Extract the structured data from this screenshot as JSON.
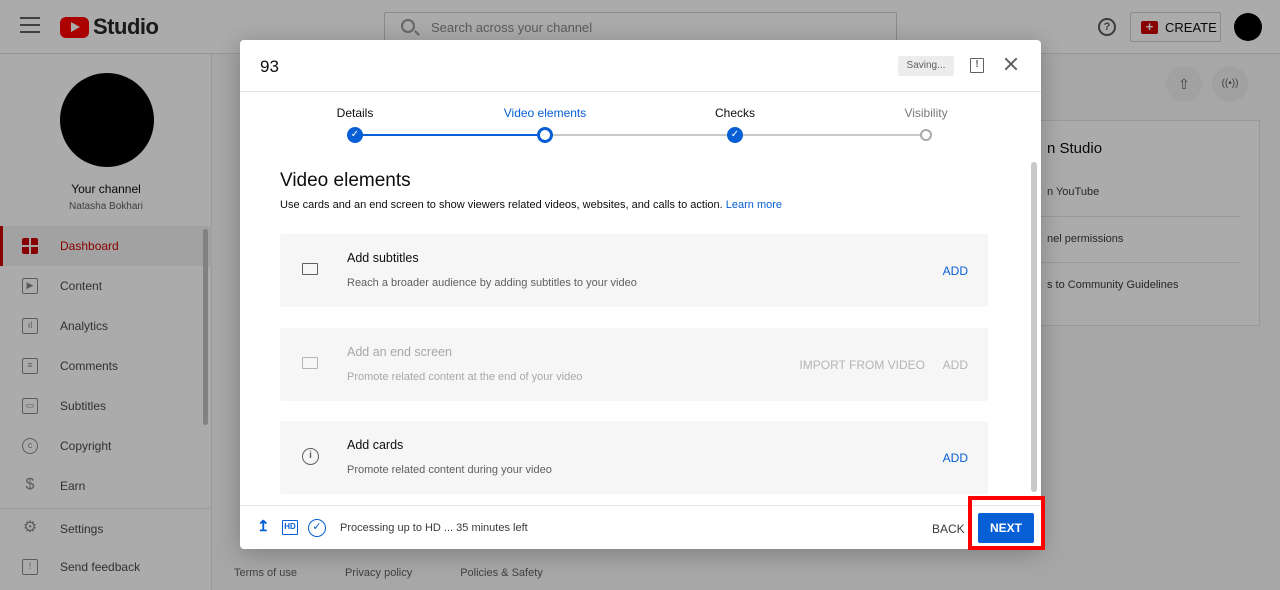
{
  "app": {
    "logo_text": "Studio"
  },
  "search": {
    "placeholder": "Search across your channel"
  },
  "header": {
    "help_glyph": "?",
    "create_label": "CREATE",
    "create_glyph": "+"
  },
  "channel": {
    "label": "Your channel",
    "name": "Natasha Bokhari"
  },
  "sidebar": {
    "items": [
      {
        "label": "Dashboard",
        "icon": "dashboard-icon",
        "glyph": "",
        "active": true
      },
      {
        "label": "Content",
        "icon": "content-icon",
        "glyph": "▶"
      },
      {
        "label": "Analytics",
        "icon": "analytics-icon",
        "glyph": "ıl"
      },
      {
        "label": "Comments",
        "icon": "comments-icon",
        "glyph": "≡"
      },
      {
        "label": "Subtitles",
        "icon": "subtitles-icon",
        "glyph": "▭"
      },
      {
        "label": "Copyright",
        "icon": "copyright-icon",
        "glyph": "c"
      },
      {
        "label": "Earn",
        "icon": "earn-icon",
        "glyph": "$"
      },
      {
        "label": "Settings",
        "icon": "settings-icon",
        "glyph": "⚙"
      },
      {
        "label": "Send feedback",
        "icon": "feedback-icon",
        "glyph": "!"
      }
    ]
  },
  "background_card": {
    "title": "n Studio",
    "items": [
      "n YouTube",
      "nel permissions",
      "s to Community Guidelines"
    ]
  },
  "right_icons": {
    "upload_glyph": "⇧",
    "live_glyph": "((•))"
  },
  "footer_links": [
    "Terms of use",
    "Privacy policy",
    "Policies & Safety"
  ],
  "modal": {
    "title": "93",
    "saving_label": "Saving...",
    "feedback_glyph": "!",
    "steps": [
      {
        "label": "Details",
        "state": "done"
      },
      {
        "label": "Video elements",
        "state": "current"
      },
      {
        "label": "Checks",
        "state": "done"
      },
      {
        "label": "Visibility",
        "state": "pending"
      }
    ],
    "step_check_glyph": "✓",
    "section_title": "Video elements",
    "section_desc": "Use cards and an end screen to show viewers related videos, websites, and calls to action.",
    "learn_more": "Learn more",
    "cards": [
      {
        "title": "Add subtitles",
        "subtitle": "Reach a broader audience by adding subtitles to your video",
        "action": "ADD",
        "icon": "subtitles-icon",
        "disabled": false
      },
      {
        "title": "Add an end screen",
        "subtitle": "Promote related content at the end of your video",
        "import_action": "IMPORT FROM VIDEO",
        "action": "ADD",
        "icon": "end-screen-icon",
        "disabled": true
      },
      {
        "title": "Add cards",
        "subtitle": "Promote related content during your video",
        "action": "ADD",
        "icon": "info-icon",
        "icon_glyph": "i",
        "disabled": false
      }
    ],
    "footer": {
      "upload_glyph": "↥",
      "hd_glyph": "HD",
      "check_glyph": "✓",
      "processing_text": "Processing up to HD ... 35 minutes left",
      "back_label": "BACK",
      "next_label": "NEXT"
    }
  },
  "colors": {
    "accent": "#065fd4",
    "brand": "#ff0000",
    "highlight": "#ff0000"
  }
}
